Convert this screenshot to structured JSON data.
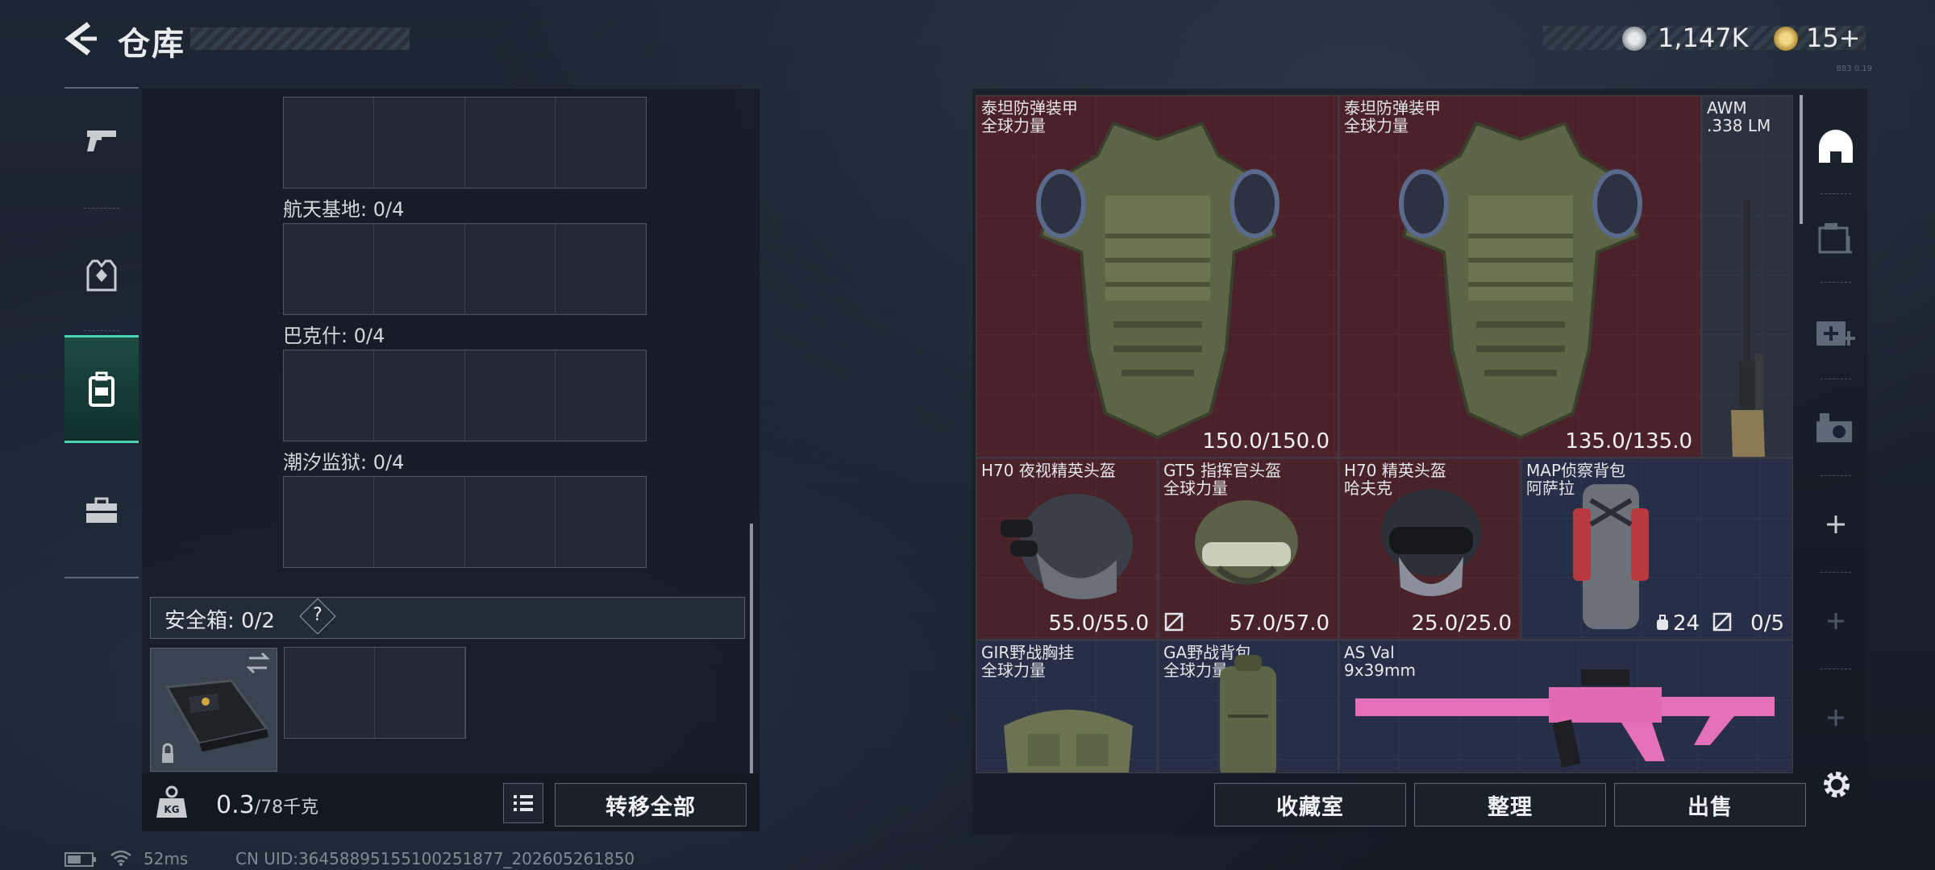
{
  "header": {
    "title": "仓库",
    "currency1_value": "1,147K",
    "currency2_value": "15+",
    "version_tag": "883 0.19"
  },
  "left_nav": {
    "items": [
      {
        "name": "weapons",
        "icon": "pistol-icon"
      },
      {
        "name": "armor",
        "icon": "vest-icon"
      },
      {
        "name": "containers",
        "icon": "backpack-icon",
        "active": true
      },
      {
        "name": "supplies",
        "icon": "briefcase-icon"
      }
    ]
  },
  "storage": {
    "sections": [
      {
        "label": "航天基地: 0/4"
      },
      {
        "label": "巴克什: 0/4"
      },
      {
        "label": "潮汐监狱: 0/4"
      }
    ],
    "safe_box_label": "安全箱:  0/2",
    "safe_box_help": "?",
    "weight_value": "0.3",
    "weight_max": "/78千克",
    "transfer_all_label": "转移全部"
  },
  "items": [
    {
      "name1": "泰坦防弹装甲",
      "name2": "全球力量",
      "durability": "150.0/150.0"
    },
    {
      "name1": "泰坦防弹装甲",
      "name2": "全球力量",
      "durability": "135.0/135.0"
    },
    {
      "name1": "AWM",
      "name2": ".338 LM"
    },
    {
      "name1": "H70 夜视精英头盔",
      "name2": "",
      "durability": "55.0/55.0"
    },
    {
      "name1": "GT5 指挥官头盔",
      "name2": "全球力量",
      "durability": "57.0/57.0"
    },
    {
      "name1": "H70 精英头盔",
      "name2": "哈夫克",
      "durability": "25.0/25.0"
    },
    {
      "name1": "MAP侦察背包",
      "name2": "阿萨拉",
      "capacity": "24",
      "count": "0/5"
    },
    {
      "name1": "GIR野战胸挂",
      "name2": "全球力量"
    },
    {
      "name1": "GA野战背包",
      "name2": "全球力量"
    },
    {
      "name1": "AS Val",
      "name2": "9x39mm"
    }
  ],
  "actions": {
    "collection_label": "收藏室",
    "sort_label": "整理",
    "sell_label": "出售"
  },
  "right_side": {
    "items": [
      "helmet-tab-icon",
      "storage-tab-icon",
      "medkit-tab-icon",
      "camera-tab-icon",
      "add-icon",
      "add-icon",
      "add-icon"
    ]
  },
  "status_bar": {
    "ping": "52ms",
    "uid": "CN UID:3645889515510025187​7_202605261850"
  },
  "colors": {
    "accent": "#4fd3b5",
    "item_red_bg": "#4b2229",
    "item_blue_bg": "#262f45"
  }
}
